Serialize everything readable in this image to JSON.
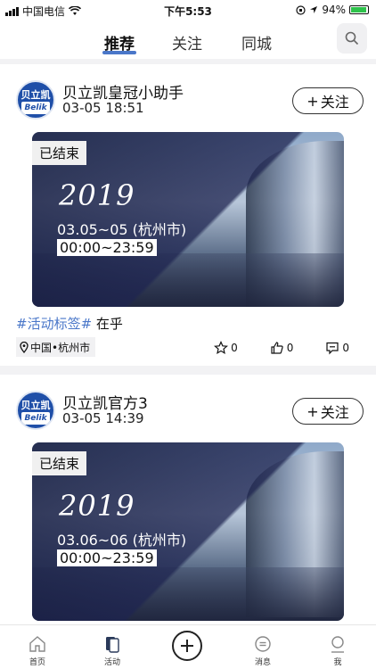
{
  "status_bar": {
    "carrier": "中国电信",
    "time": "下午5:53",
    "battery": "94%"
  },
  "top_nav": {
    "tabs": [
      {
        "label": "推荐",
        "active": true
      },
      {
        "label": "关注",
        "active": false
      },
      {
        "label": "同城",
        "active": false
      }
    ]
  },
  "feed": [
    {
      "author": "贝立凯皇冠小助手",
      "time": "03-05 18:51",
      "follow_label": "关注",
      "avatar": {
        "top": "贝立凯",
        "bottom": "Belik"
      },
      "banner": {
        "status": "已结束",
        "year": "2019",
        "dates": "03.05~05 (杭州市)",
        "hours": "00:00~23:59"
      },
      "tag": "#活动标签#",
      "text": "在乎",
      "location": "中国•杭州市",
      "favorites": "0",
      "likes": "0",
      "comments": "0"
    },
    {
      "author": "贝立凯官方3",
      "time": "03-05 14:39",
      "follow_label": "关注",
      "avatar": {
        "top": "贝立凯",
        "bottom": "Belik"
      },
      "banner": {
        "status": "已结束",
        "year": "2019",
        "dates": "03.06~06 (杭州市)",
        "hours": "00:00~23:59"
      }
    }
  ],
  "bottom_nav": [
    {
      "label": "首页",
      "icon": "home-icon"
    },
    {
      "label": "活动",
      "icon": "activity-icon",
      "active": true
    },
    {
      "label": "",
      "icon": "plus-icon"
    },
    {
      "label": "消息",
      "icon": "message-icon"
    },
    {
      "label": "我",
      "icon": "profile-icon"
    }
  ],
  "colors": {
    "accent": "#4a77c9",
    "battery": "#2ec24b"
  }
}
